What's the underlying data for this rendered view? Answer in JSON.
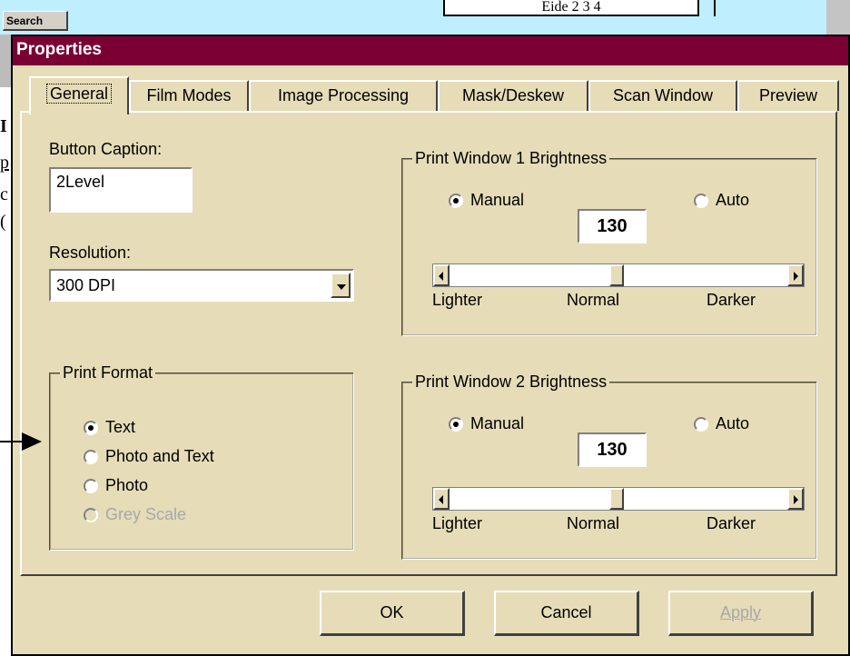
{
  "background": {
    "search_button": "Search",
    "partial_box_text": "Eide 2 3 4",
    "partial_left_chars": [
      "I",
      "p",
      "c",
      "("
    ]
  },
  "dialog": {
    "title": "Properties",
    "tabs": [
      {
        "label": "General",
        "active": true
      },
      {
        "label": "Film Modes"
      },
      {
        "label": "Image Processing"
      },
      {
        "label": "Mask/Deskew"
      },
      {
        "label": "Scan Window"
      },
      {
        "label": "Preview"
      }
    ],
    "general": {
      "button_caption": {
        "label": "Button Caption:",
        "value": "2Level"
      },
      "resolution": {
        "label": "Resolution:",
        "value": "300 DPI"
      },
      "print_format": {
        "title": "Print Format",
        "options": [
          {
            "label": "Text",
            "checked": true,
            "disabled": false
          },
          {
            "label": "Photo and Text",
            "checked": false,
            "disabled": false
          },
          {
            "label": "Photo",
            "checked": false,
            "disabled": false
          },
          {
            "label": "Grey Scale",
            "checked": false,
            "disabled": true
          }
        ]
      },
      "print_window_1": {
        "title": "Print Window 1 Brightness",
        "manual_label": "Manual",
        "auto_label": "Auto",
        "mode": "Manual",
        "value": "130",
        "slider_position": 0.5,
        "lighter_label": "Lighter",
        "normal_label": "Normal",
        "darker_label": "Darker"
      },
      "print_window_2": {
        "title": "Print Window 2 Brightness",
        "manual_label": "Manual",
        "auto_label": "Auto",
        "mode": "Manual",
        "value": "130",
        "slider_position": 0.5,
        "lighter_label": "Lighter",
        "normal_label": "Normal",
        "darker_label": "Darker"
      }
    },
    "buttons": {
      "ok": "OK",
      "cancel": "Cancel",
      "apply": "Apply",
      "apply_disabled": true
    }
  },
  "colors": {
    "title_bar": "#7a0033",
    "dialog_bg": "#e6dcb8",
    "app_bg": "#bfefff"
  }
}
